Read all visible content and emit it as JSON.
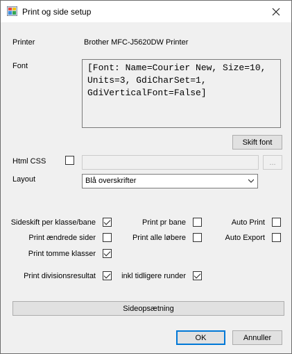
{
  "window": {
    "title": "Print og side setup"
  },
  "printer": {
    "label": "Printer",
    "value": "Brother MFC-J5620DW Printer"
  },
  "font": {
    "label": "Font",
    "value": "[Font: Name=Courier New, Size=10,\nUnits=3, GdiCharSet=1,\nGdiVerticalFont=False]",
    "change_button": "Skift font"
  },
  "html_css": {
    "label": "Html CSS",
    "checked": false,
    "value": "",
    "browse_button": "..."
  },
  "layout": {
    "label": "Layout",
    "selected": "Blå overskrifter"
  },
  "options": {
    "sideskift": {
      "label": "Sideskift per klasse/bane",
      "checked": true
    },
    "print_aendrede": {
      "label": "Print ændrede sider",
      "checked": false
    },
    "print_tomme": {
      "label": "Print tomme klasser",
      "checked": true
    },
    "print_division": {
      "label": "Print divisionsresultat",
      "checked": true
    },
    "print_pr_bane": {
      "label": "Print pr bane",
      "checked": false
    },
    "print_alle": {
      "label": "Print alle løbere",
      "checked": false
    },
    "inkl_tidligere": {
      "label": "inkl tidligere runder",
      "checked": true
    },
    "auto_print": {
      "label": "Auto Print",
      "checked": false
    },
    "auto_export": {
      "label": "Auto Export",
      "checked": false
    }
  },
  "page_setup_button": "Sideopsætning",
  "ok_button": "OK",
  "cancel_button": "Annuller"
}
